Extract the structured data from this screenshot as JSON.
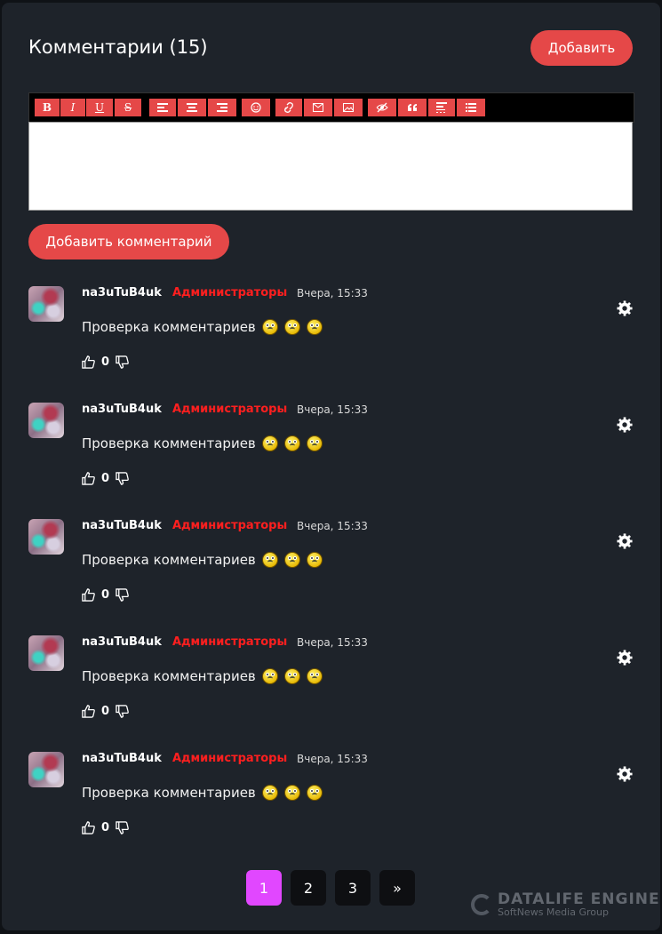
{
  "header": {
    "title": "Комментарии (15)",
    "add_label": "Добавить"
  },
  "editor": {
    "toolbar": [
      "bold",
      "italic",
      "underline",
      "strikethrough",
      "align-left",
      "align-center",
      "align-right",
      "emoji",
      "link",
      "email",
      "image",
      "hide",
      "quote",
      "spoiler",
      "list"
    ],
    "toolbar_labels": {
      "bold": "B",
      "italic": "I",
      "underline": "U",
      "strikethrough": "S"
    },
    "submit_label": "Добавить комментарий"
  },
  "comments": [
    {
      "author": "na3uTuB4uk",
      "group": "Администраторы",
      "date": "Вчера, 15:33",
      "text": "Проверка комментариев",
      "rating": "0"
    },
    {
      "author": "na3uTuB4uk",
      "group": "Администраторы",
      "date": "Вчера, 15:33",
      "text": "Проверка комментариев",
      "rating": "0"
    },
    {
      "author": "na3uTuB4uk",
      "group": "Администраторы",
      "date": "Вчера, 15:33",
      "text": "Проверка комментариев",
      "rating": "0"
    },
    {
      "author": "na3uTuB4uk",
      "group": "Администраторы",
      "date": "Вчера, 15:33",
      "text": "Проверка комментариев",
      "rating": "0"
    },
    {
      "author": "na3uTuB4uk",
      "group": "Администраторы",
      "date": "Вчера, 15:33",
      "text": "Проверка комментариев",
      "rating": "0"
    }
  ],
  "pagination": {
    "pages": [
      "1",
      "2",
      "3"
    ],
    "next": "»",
    "current": "1"
  },
  "branding": {
    "line1": "DATALIFE ENGINE",
    "line2": "SoftNews Media Group"
  },
  "colors": {
    "accent": "#e54848",
    "group": "#ff1f1f",
    "active_page": "#e147ff",
    "panel": "#1e232a"
  }
}
